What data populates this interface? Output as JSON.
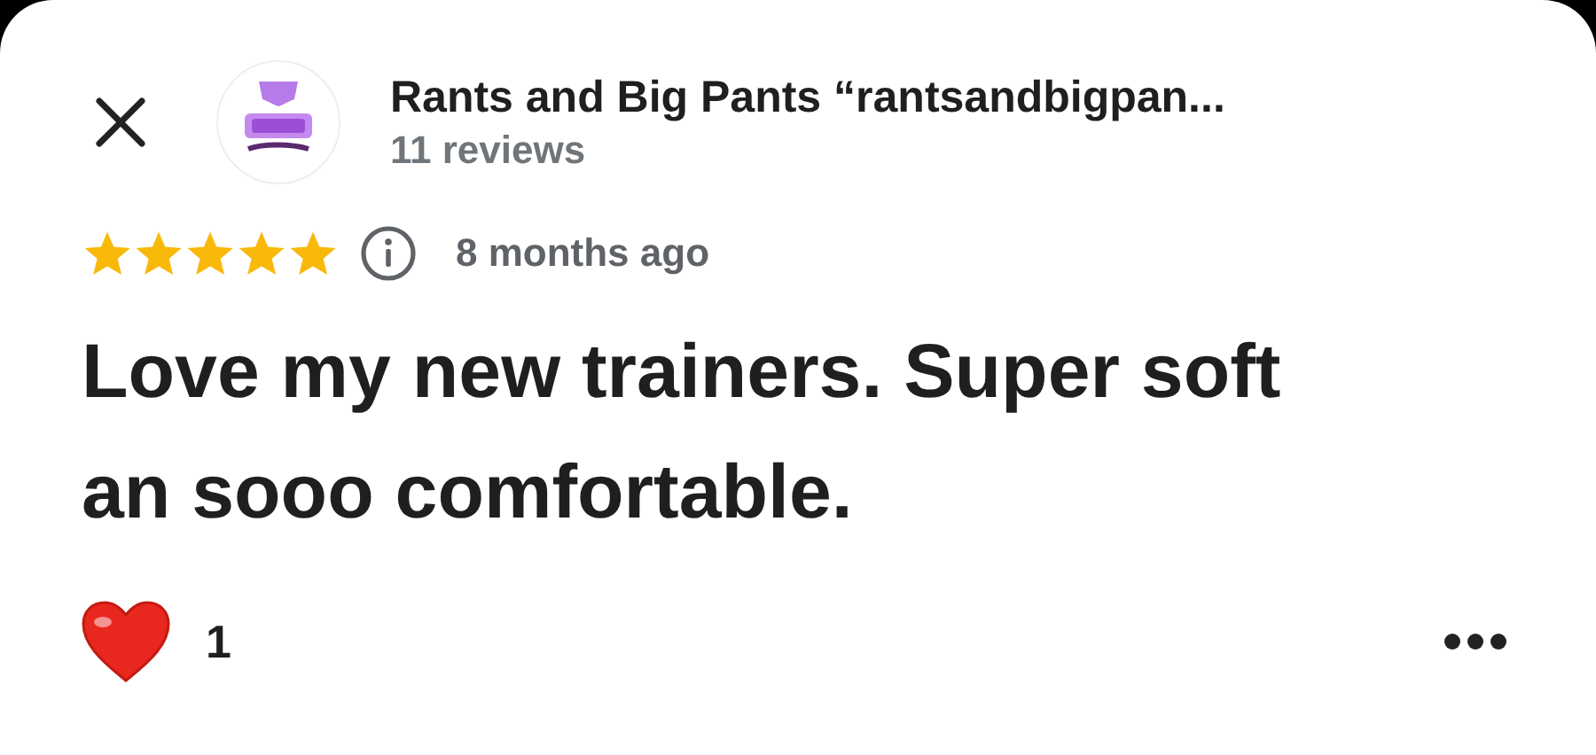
{
  "header": {
    "title": "Rants and Big Pants “rantsandbigpan...",
    "subtitle": "11 reviews"
  },
  "review": {
    "stars": 5,
    "time": "8 months ago",
    "text": "Love my new trainers. Super soft an sooo comfortable."
  },
  "reactions": {
    "liked": true,
    "count": "1"
  }
}
